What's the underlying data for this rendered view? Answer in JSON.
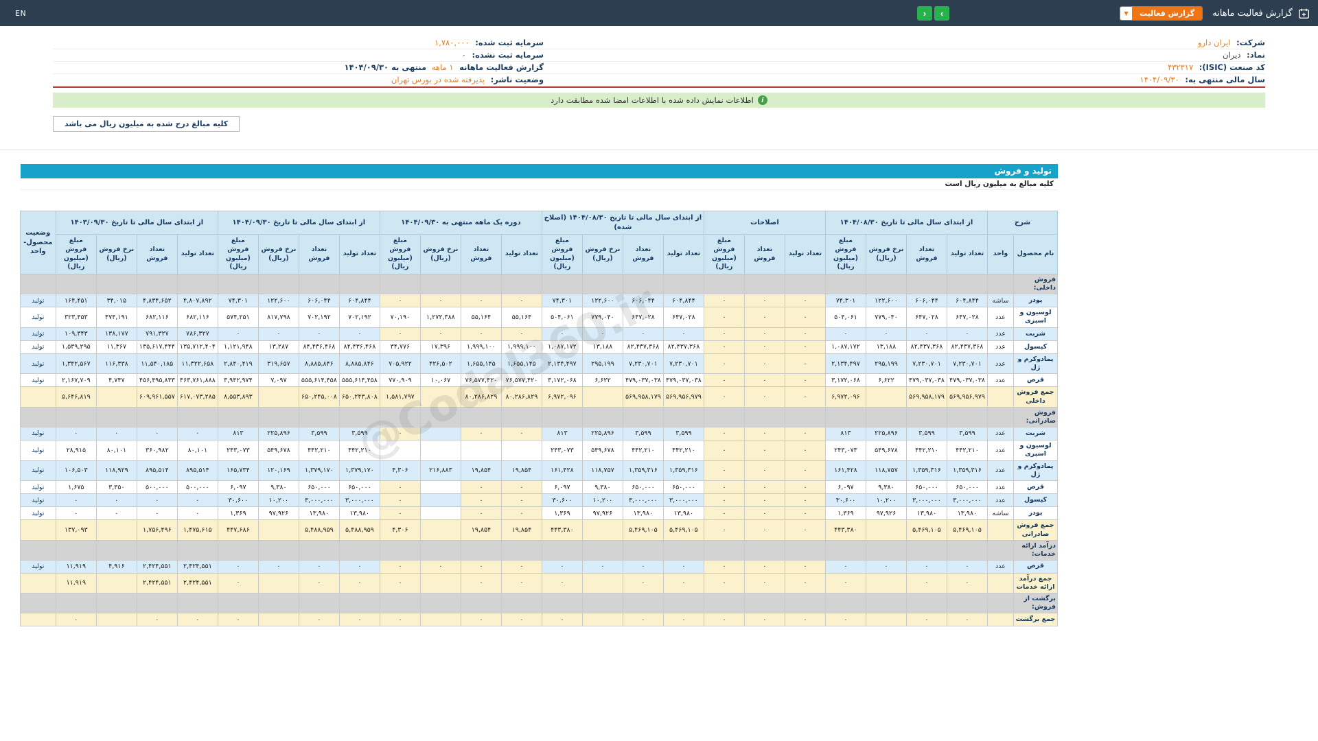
{
  "topbar": {
    "title": "گزارش فعالیت ماهانه",
    "report_type": "گزارش فعالیت",
    "en": "EN",
    "accent_orange": "#ee7414",
    "accent_green": "#27b24e",
    "bar_color": "#2d3e50"
  },
  "company": {
    "right": [
      {
        "label": "شرکت:",
        "value": "ایران دارو"
      },
      {
        "label": "نماد:",
        "value": "دیران"
      },
      {
        "label": "کد صنعت (ISIC):",
        "value": "۴۳۲۳۱۷"
      },
      {
        "label": "سال مالی منتهی به:",
        "value": "۱۴۰۴/۰۹/۳۰"
      }
    ],
    "left": [
      {
        "label": "سرمایه ثبت شده:",
        "value": "۱,۷۸۰,۰۰۰"
      },
      {
        "label": "سرمایه ثبت نشده:",
        "value": "۰"
      },
      {
        "label": "گزارش فعالیت ماهانه",
        "value": "۱ ماهه",
        "suffix": "منتهی به ۱۴۰۴/۰۹/۳۰"
      },
      {
        "label": "وضعیت ناشر:",
        "value": "پذیرفته شده در بورس تهران"
      }
    ]
  },
  "banner": {
    "text": "اطلاعات نمایش داده شده با اطلاعات امضا شده مطابقت دارد"
  },
  "note_tab": {
    "text": "کلیه مبالغ درج شده به میلیون ریال می باشد"
  },
  "section": {
    "title": "تولید و فروش",
    "note": "کلیه مبالغ به میلیون ریال است"
  },
  "watermark": "@Codal360.ir",
  "table": {
    "groups": [
      {
        "label": "شرح",
        "cols": [
          "نام محصول",
          "واحد"
        ]
      },
      {
        "label": "از ابتدای سال مالی تا تاریخ ۱۴۰۴/۰۸/۳۰",
        "cols": [
          "تعداد تولید",
          "تعداد فروش",
          "نرخ فروش (ریال)",
          "مبلغ فروش (میلیون ریال)"
        ]
      },
      {
        "label": "اصلاحات",
        "cols": [
          "تعداد تولید",
          "تعداد فروش",
          "مبلغ فروش (میلیون ریال)"
        ]
      },
      {
        "label": "از ابتدای سال مالی تا تاریخ ۱۴۰۴/۰۸/۳۰ (اصلاح شده)",
        "cols": [
          "تعداد تولید",
          "تعداد فروش",
          "نرخ فروش (ریال)",
          "مبلغ فروش (میلیون ریال)"
        ]
      },
      {
        "label": "دوره یک ماهه منتهی به ۱۴۰۴/۰۹/۳۰",
        "cols": [
          "تعداد تولید",
          "تعداد فروش",
          "نرخ فروش (ریال)",
          "مبلغ فروش (میلیون ریال)"
        ]
      },
      {
        "label": "از ابتدای سال مالی تا تاریخ ۱۴۰۴/۰۹/۳۰",
        "cols": [
          "تعداد تولید",
          "تعداد فروش",
          "نرخ فروش (ریال)",
          "مبلغ فروش (میلیون ریال)"
        ]
      },
      {
        "label": "از ابتدای سال مالی تا تاریخ ۱۴۰۳/۰۹/۳۰",
        "cols": [
          "تعداد تولید",
          "تعداد فروش",
          "نرخ فروش (ریال)",
          "مبلغ فروش (میلیون ریال)"
        ]
      },
      {
        "label": "وضعیت محصول-واحد",
        "cols": []
      }
    ],
    "rows": [
      {
        "type": "section",
        "name": "فروش داخلی:"
      },
      {
        "type": "data",
        "name": "پودر",
        "unit": "ساشه",
        "status": "تولید",
        "cells": [
          "۶۰۴,۸۴۴",
          "۶۰۶,۰۴۴",
          "۱۲۲,۶۰۰",
          "۷۴,۳۰۱",
          "۰",
          "۰",
          "۰",
          "۶۰۴,۸۴۴",
          "۶۰۶,۰۴۴",
          "۱۲۲,۶۰۰",
          "۷۴,۳۰۱",
          "۰",
          "۰",
          "۰",
          "۰",
          "۶۰۴,۸۴۴",
          "۶۰۶,۰۴۴",
          "۱۲۲,۶۰۰",
          "۷۴,۳۰۱",
          "۴,۸۰۷,۸۹۲",
          "۴,۸۳۴,۶۵۲",
          "۳۴,۰۱۵",
          "۱۶۴,۴۵۱"
        ]
      },
      {
        "type": "data",
        "name": "لوسیون و اسپری",
        "unit": "عدد",
        "status": "تولید",
        "cells": [
          "۶۴۷,۰۲۸",
          "۶۴۷,۰۲۸",
          "۷۷۹,۰۴۰",
          "۵۰۴,۰۶۱",
          "۰",
          "۰",
          "۰",
          "۶۴۷,۰۲۸",
          "۶۴۷,۰۲۸",
          "۷۷۹,۰۴۰",
          "۵۰۴,۰۶۱",
          "۵۵,۱۶۴",
          "۵۵,۱۶۴",
          "۱,۲۷۲,۳۸۸",
          "۷۰,۱۹۰",
          "۷۰۲,۱۹۲",
          "۷۰۲,۱۹۲",
          "۸۱۷,۷۹۸",
          "۵۷۴,۲۵۱",
          "۶۸۲,۱۱۶",
          "۶۸۲,۱۱۶",
          "۴۷۴,۱۹۱",
          "۳۲۳,۴۵۳"
        ]
      },
      {
        "type": "data",
        "name": "شربت",
        "unit": "عدد",
        "status": "تولید",
        "cells": [
          "۰",
          "۰",
          "۰",
          "۰",
          "۰",
          "۰",
          "۰",
          "۰",
          "۰",
          "۰",
          "۰",
          "۰",
          "۰",
          "۰",
          "۰",
          "۰",
          "۰",
          "۰",
          "۰",
          "۷۸۶,۳۲۷",
          "۷۹۱,۳۲۷",
          "۱۳۸,۱۷۷",
          "۱۰۹,۳۴۳"
        ]
      },
      {
        "type": "data",
        "name": "کپسول",
        "unit": "عدد",
        "status": "تولید",
        "cells": [
          "۸۲,۴۳۷,۳۶۸",
          "۸۲,۴۳۷,۳۶۸",
          "۱۳,۱۸۸",
          "۱,۰۸۷,۱۷۲",
          "۰",
          "۰",
          "۰",
          "۸۲,۴۳۷,۳۶۸",
          "۸۲,۴۳۷,۳۶۸",
          "۱۳,۱۸۸",
          "۱,۰۸۷,۱۷۲",
          "۱,۹۹۹,۱۰۰",
          "۱,۹۹۹,۱۰۰",
          "۱۷,۳۹۶",
          "۳۴,۷۷۶",
          "۸۴,۴۳۶,۴۶۸",
          "۸۴,۴۳۶,۴۶۸",
          "۱۳,۲۸۷",
          "۱,۱۲۱,۹۴۸",
          "۱۳۵,۷۱۲,۴۰۴",
          "۱۳۵,۶۱۷,۴۴۴",
          "۱۱,۳۶۷",
          "۱,۵۳۹,۲۹۵"
        ]
      },
      {
        "type": "data",
        "name": "پمادوکرم و ژل",
        "unit": "عدد",
        "status": "تولید",
        "cells": [
          "۷,۲۳۰,۷۰۱",
          "۷,۲۳۰,۷۰۱",
          "۲۹۵,۱۹۹",
          "۲,۱۳۴,۴۹۷",
          "۰",
          "۰",
          "۰",
          "۷,۲۳۰,۷۰۱",
          "۷,۲۳۰,۷۰۱",
          "۲۹۵,۱۹۹",
          "۲,۱۳۴,۴۹۷",
          "۱,۶۵۵,۱۴۵",
          "۱,۶۵۵,۱۴۵",
          "۴۲۶,۵۰۲",
          "۷۰۵,۹۲۲",
          "۸,۸۸۵,۸۴۶",
          "۸,۸۸۵,۸۴۶",
          "۳۱۹,۶۵۷",
          "۲,۸۴۰,۴۱۹",
          "۱۱,۳۲۲,۶۵۸",
          "۱۱,۵۴۰,۱۸۵",
          "۱۱۶,۳۳۸",
          "۱,۳۴۲,۵۶۷"
        ]
      },
      {
        "type": "data",
        "name": "قرص",
        "unit": "عدد",
        "status": "تولید",
        "cells": [
          "۴۷۹,۰۳۷,۰۳۸",
          "۴۷۹,۰۳۷,۰۳۸",
          "۶,۶۲۲",
          "۳,۱۷۲,۰۶۸",
          "۰",
          "۰",
          "۰",
          "۴۷۹,۰۳۷,۰۳۸",
          "۴۷۹,۰۳۷,۰۳۸",
          "۶,۶۲۲",
          "۳,۱۷۲,۰۶۸",
          "۷۶,۵۷۷,۴۲۰",
          "۷۶,۵۷۷,۴۲۰",
          "۱۰,۰۶۷",
          "۷۷۰,۹۰۹",
          "۵۵۵,۶۱۴,۴۵۸",
          "۵۵۵,۶۱۴,۴۵۸",
          "۷,۰۹۷",
          "۳,۹۴۲,۹۷۴",
          "۴۶۳,۷۶۱,۸۸۸",
          "۴۵۶,۴۹۵,۸۳۳",
          "۴,۷۴۷",
          "۲,۱۶۷,۷۰۹"
        ]
      },
      {
        "type": "total",
        "name": "جمع فروش داخلی",
        "unit": "",
        "status": "",
        "cells": [
          "۵۶۹,۹۵۶,۹۷۹",
          "۵۶۹,۹۵۸,۱۷۹",
          "",
          "۶,۹۷۲,۰۹۶",
          "۰",
          "۰",
          "۰",
          "۵۶۹,۹۵۶,۹۷۹",
          "۵۶۹,۹۵۸,۱۷۹",
          "",
          "۶,۹۷۲,۰۹۶",
          "۸۰,۲۸۶,۸۲۹",
          "۸۰,۲۸۶,۸۲۹",
          "",
          "۱,۵۸۱,۷۹۷",
          "۶۵۰,۲۴۳,۸۰۸",
          "۶۵۰,۲۴۵,۰۰۸",
          "",
          "۸,۵۵۳,۸۹۳",
          "۶۱۷,۰۷۳,۲۸۵",
          "۶۰۹,۹۶۱,۵۵۷",
          "",
          "۵,۶۴۶,۸۱۹"
        ]
      },
      {
        "type": "section",
        "name": "فروش صادراتی:"
      },
      {
        "type": "data",
        "name": "شربت",
        "unit": "عدد",
        "status": "تولید",
        "cells": [
          "۳,۵۹۹",
          "۳,۵۹۹",
          "۲۲۵,۸۹۶",
          "۸۱۳",
          "۰",
          "۰",
          "۰",
          "۳,۵۹۹",
          "۳,۵۹۹",
          "۲۲۵,۸۹۶",
          "۸۱۳",
          "۰",
          "۰",
          "",
          "۰",
          "۳,۵۹۹",
          "۳,۵۹۹",
          "۲۲۵,۸۹۶",
          "۸۱۳",
          "۰",
          "۰",
          "۰",
          "۰"
        ]
      },
      {
        "type": "data",
        "name": "لوسیون و اسپری",
        "unit": "عدد",
        "status": "تولید",
        "cells": [
          "۴۴۲,۲۱۰",
          "۴۴۲,۲۱۰",
          "۵۴۹,۶۷۸",
          "۲۴۳,۰۷۳",
          "۰",
          "۰",
          "۰",
          "۴۴۲,۲۱۰",
          "۴۴۲,۲۱۰",
          "۵۴۹,۶۷۸",
          "۲۴۳,۰۷۳",
          "",
          "",
          "",
          "",
          "۴۴۲,۲۱۰",
          "۴۴۲,۲۱۰",
          "۵۴۹,۶۷۸",
          "۲۴۳,۰۷۳",
          "۸۰,۱۰۱",
          "۳۶۰,۹۸۲",
          "۸۰,۱۰۱",
          "۲۸,۹۱۵"
        ]
      },
      {
        "type": "data",
        "name": "پمادوکرم و ژل",
        "unit": "عدد",
        "status": "تولید",
        "cells": [
          "۱,۳۵۹,۳۱۶",
          "۱,۳۵۹,۳۱۶",
          "۱۱۸,۷۵۷",
          "۱۶۱,۴۲۸",
          "۰",
          "۰",
          "۰",
          "۱,۳۵۹,۳۱۶",
          "۱,۳۵۹,۳۱۶",
          "۱۱۸,۷۵۷",
          "۱۶۱,۴۲۸",
          "۱۹,۸۵۴",
          "۱۹,۸۵۴",
          "۲۱۶,۸۸۳",
          "۴,۳۰۶",
          "۱,۳۷۹,۱۷۰",
          "۱,۳۷۹,۱۷۰",
          "۱۲۰,۱۶۹",
          "۱۶۵,۷۳۴",
          "۸۹۵,۵۱۴",
          "۸۹۵,۵۱۴",
          "۱۱۸,۹۲۹",
          "۱۰۶,۵۰۳"
        ]
      },
      {
        "type": "data",
        "name": "قرص",
        "unit": "عدد",
        "status": "تولید",
        "cells": [
          "۶۵۰,۰۰۰",
          "۶۵۰,۰۰۰",
          "۹,۳۸۰",
          "۶,۰۹۷",
          "۰",
          "۰",
          "۰",
          "۶۵۰,۰۰۰",
          "۶۵۰,۰۰۰",
          "۹,۳۸۰",
          "۶,۰۹۷",
          "۰",
          "۰",
          "",
          "۰",
          "۶۵۰,۰۰۰",
          "۶۵۰,۰۰۰",
          "۹,۳۸۰",
          "۶,۰۹۷",
          "۵۰۰,۰۰۰",
          "۵۰۰,۰۰۰",
          "۳,۳۵۰",
          "۱,۶۷۵"
        ]
      },
      {
        "type": "data",
        "name": "کپسول",
        "unit": "عدد",
        "status": "تولید",
        "cells": [
          "۳,۰۰۰,۰۰۰",
          "۳,۰۰۰,۰۰۰",
          "۱۰,۲۰۰",
          "۳۰,۶۰۰",
          "۰",
          "۰",
          "۰",
          "۳,۰۰۰,۰۰۰",
          "۳,۰۰۰,۰۰۰",
          "۱۰,۲۰۰",
          "۳۰,۶۰۰",
          "۰",
          "۰",
          "",
          "۰",
          "۳,۰۰۰,۰۰۰",
          "۳,۰۰۰,۰۰۰",
          "۱۰,۲۰۰",
          "۳۰,۶۰۰",
          "۰",
          "۰",
          "۰",
          "۰"
        ]
      },
      {
        "type": "data",
        "name": "پودر",
        "unit": "ساشه",
        "status": "تولید",
        "cells": [
          "۱۳,۹۸۰",
          "۱۳,۹۸۰",
          "۹۷,۹۲۶",
          "۱,۳۶۹",
          "۰",
          "۰",
          "۰",
          "۱۳,۹۸۰",
          "۱۳,۹۸۰",
          "۹۷,۹۲۶",
          "۱,۳۶۹",
          "۰",
          "۰",
          "",
          "۰",
          "۱۳,۹۸۰",
          "۱۳,۹۸۰",
          "۹۷,۹۲۶",
          "۱,۳۶۹",
          "۰",
          "۰",
          "۰",
          "۰"
        ]
      },
      {
        "type": "total",
        "name": "جمع فروش صادراتی",
        "unit": "",
        "status": "",
        "cells": [
          "۵,۴۶۹,۱۰۵",
          "۵,۴۶۹,۱۰۵",
          "",
          "۴۴۳,۳۸۰",
          "۰",
          "۰",
          "۰",
          "۵,۴۶۹,۱۰۵",
          "۵,۴۶۹,۱۰۵",
          "",
          "۴۴۳,۳۸۰",
          "۱۹,۸۵۴",
          "۱۹,۸۵۴",
          "",
          "۴,۳۰۶",
          "۵,۴۸۸,۹۵۹",
          "۵,۴۸۸,۹۵۹",
          "",
          "۴۴۷,۶۸۶",
          "۱,۴۷۵,۶۱۵",
          "۱,۷۵۶,۴۹۶",
          "",
          "۱۳۷,۰۹۳"
        ]
      },
      {
        "type": "section",
        "name": "درآمد ارائه خدمات:"
      },
      {
        "type": "data",
        "name": "قرص",
        "unit": "عدد",
        "status": "تولید",
        "cells": [
          "۰",
          "۰",
          "۰",
          "۰",
          "۰",
          "۰",
          "۰",
          "۰",
          "۰",
          "۰",
          "۰",
          "۰",
          "۰",
          "۰",
          "۰",
          "۰",
          "۰",
          "۰",
          "۰",
          "۲,۴۲۴,۵۵۱",
          "۲,۴۲۴,۵۵۱",
          "۴,۹۱۶",
          "۱۱,۹۱۹"
        ]
      },
      {
        "type": "total",
        "name": "جمع درآمد ارائه خدمات",
        "unit": "",
        "status": "",
        "cells": [
          "۰",
          "۰",
          "",
          "۰",
          "۰",
          "۰",
          "۰",
          "۰",
          "۰",
          "",
          "۰",
          "۰",
          "۰",
          "",
          "۰",
          "۰",
          "۰",
          "",
          "۰",
          "۲,۴۲۴,۵۵۱",
          "۲,۴۲۴,۵۵۱",
          "",
          "۱۱,۹۱۹"
        ]
      },
      {
        "type": "section",
        "name": "برگشت از فروش:"
      },
      {
        "type": "total",
        "name": "جمع برگشت",
        "unit": "",
        "status": "",
        "cells": [
          "۰",
          "۰",
          "",
          "۰",
          "۰",
          "۰",
          "۰",
          "۰",
          "۰",
          "",
          "۰",
          "۰",
          "۰",
          "",
          "۰",
          "۰",
          "۰",
          "",
          "۰",
          "۰",
          "۰",
          "",
          "۰"
        ]
      }
    ]
  }
}
